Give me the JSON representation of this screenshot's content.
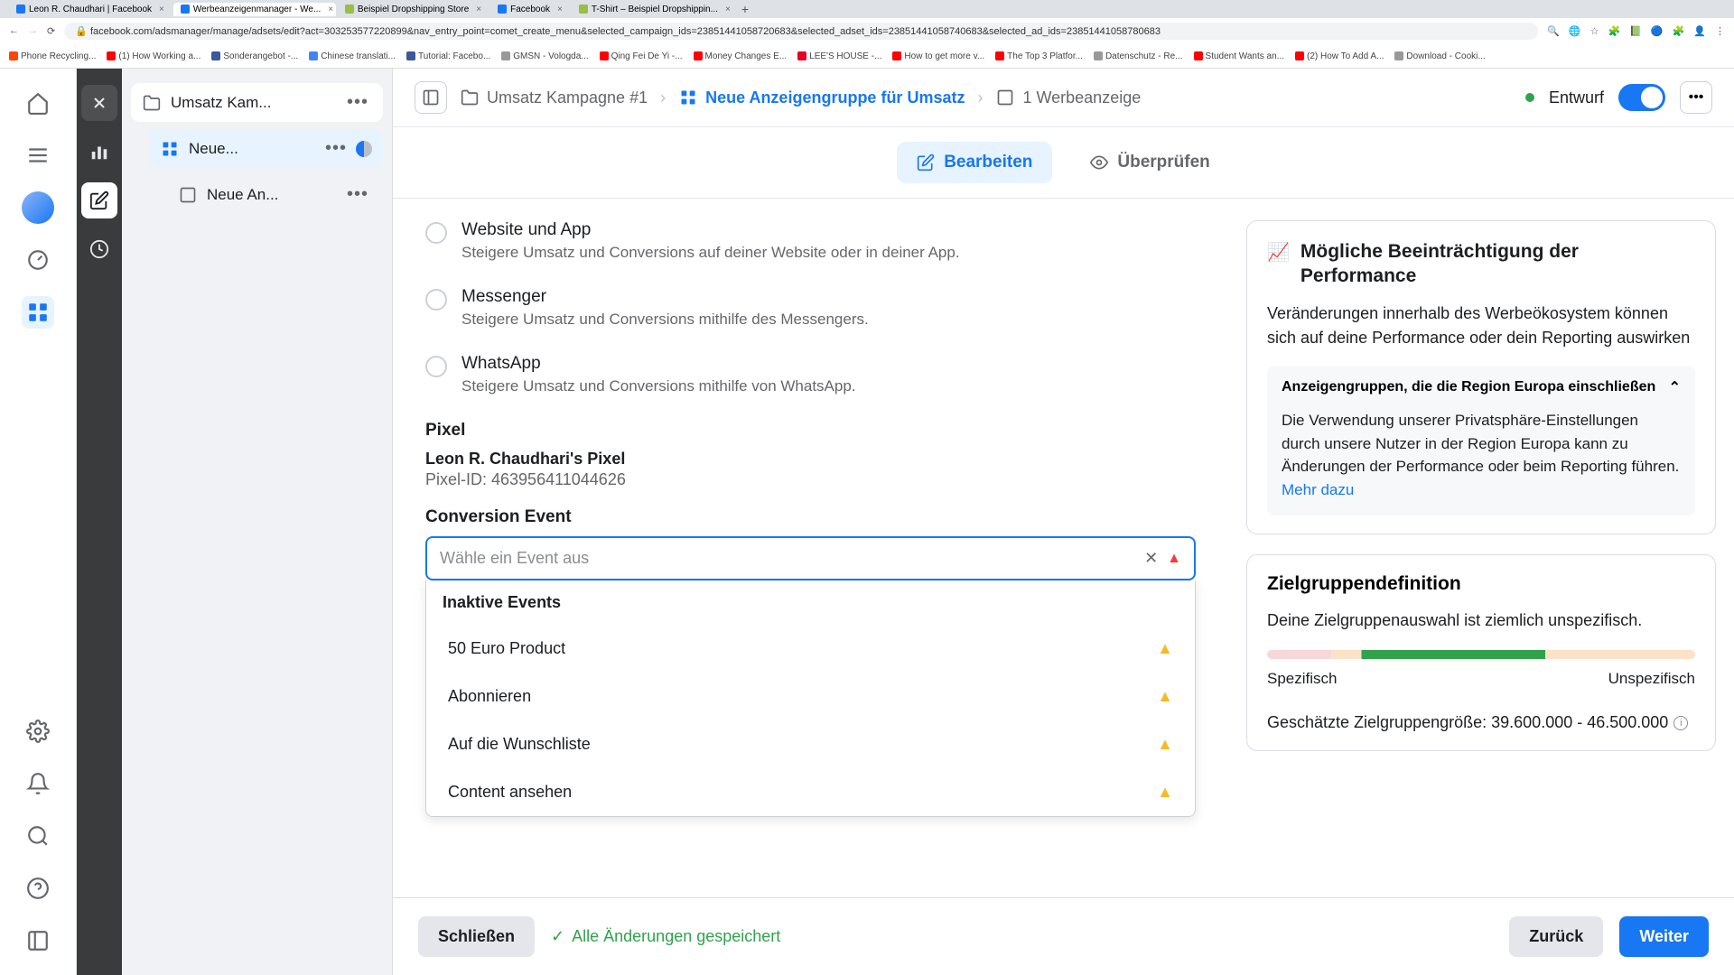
{
  "browser": {
    "tabs": [
      {
        "title": "Leon R. Chaudhari | Facebook"
      },
      {
        "title": "Werbeanzeigenmanager - We..."
      },
      {
        "title": "Beispiel Dropshipping Store"
      },
      {
        "title": "Facebook"
      },
      {
        "title": "T-Shirt – Beispiel Dropshippin..."
      }
    ],
    "url": "facebook.com/adsmanager/manage/adsets/edit?act=303253577220899&nav_entry_point=comet_create_menu&selected_campaign_ids=23851441058720683&selected_adset_ids=23851441058740683&selected_ad_ids=23851441058780683",
    "bookmarks": [
      "Phone Recycling...",
      "(1) How Working a...",
      "Sonderangebot -...",
      "Chinese translati...",
      "Tutorial: Facebo...",
      "GMSN - Vologda...",
      "Qing Fei De Yi -...",
      "Money Changes E...",
      "LEE'S HOUSE -...",
      "How to get more v...",
      "The Top 3 Platfor...",
      "Datenschutz - Re...",
      "Student Wants an...",
      "(2) How To Add A...",
      "Download - Cooki..."
    ]
  },
  "tree": {
    "campaign": "Umsatz Kam...",
    "adset": "Neue...",
    "ad": "Neue An..."
  },
  "crumbs": {
    "campaign": "Umsatz Kampagne #1",
    "adset": "Neue Anzeigengruppe für Umsatz",
    "ad": "1 Werbeanzeige",
    "status": "Entwurf"
  },
  "subtabs": {
    "edit": "Bearbeiten",
    "review": "Überprüfen"
  },
  "conversion_location": {
    "options": [
      {
        "title": "Website und App",
        "desc": "Steigere Umsatz und Conversions auf deiner Website oder in deiner App."
      },
      {
        "title": "Messenger",
        "desc": "Steigere Umsatz und Conversions mithilfe des Messengers."
      },
      {
        "title": "WhatsApp",
        "desc": "Steigere Umsatz und Conversions mithilfe von WhatsApp."
      }
    ]
  },
  "pixel": {
    "heading": "Pixel",
    "name": "Leon R. Chaudhari's Pixel",
    "id_label": "Pixel-ID: 463956411044626"
  },
  "conversion_event": {
    "heading": "Conversion Event",
    "placeholder": "Wähle ein Event aus",
    "dropdown_header": "Inaktive Events",
    "options": [
      "50 Euro Product",
      "Abonnieren",
      "Auf die Wunschliste",
      "Content ansehen"
    ]
  },
  "perf_panel": {
    "title": "Mögliche Beeinträchtigung der Performance",
    "body": "Veränderungen innerhalb des Werbeökosystem können sich auf deine Performance oder dein Reporting auswirken",
    "sub_title": "Anzeigengruppen, die die Region Europa einschließen",
    "sub_body": "Die Verwendung unserer Privatsphäre-Einstellungen durch unsere Nutzer in der Region Europa kann zu Änderungen der Performance oder beim Reporting führen. ",
    "more": "Mehr dazu"
  },
  "audience": {
    "title": "Zielgruppendefinition",
    "desc": "Deine Zielgruppenauswahl ist ziemlich unspezifisch.",
    "label_left": "Spezifisch",
    "label_right": "Unspezifisch",
    "size": "Geschätzte Zielgruppengröße: 39.600.000 - 46.500.000"
  },
  "footer": {
    "close": "Schließen",
    "saved": "Alle Änderungen gespeichert",
    "back": "Zurück",
    "next": "Weiter"
  }
}
